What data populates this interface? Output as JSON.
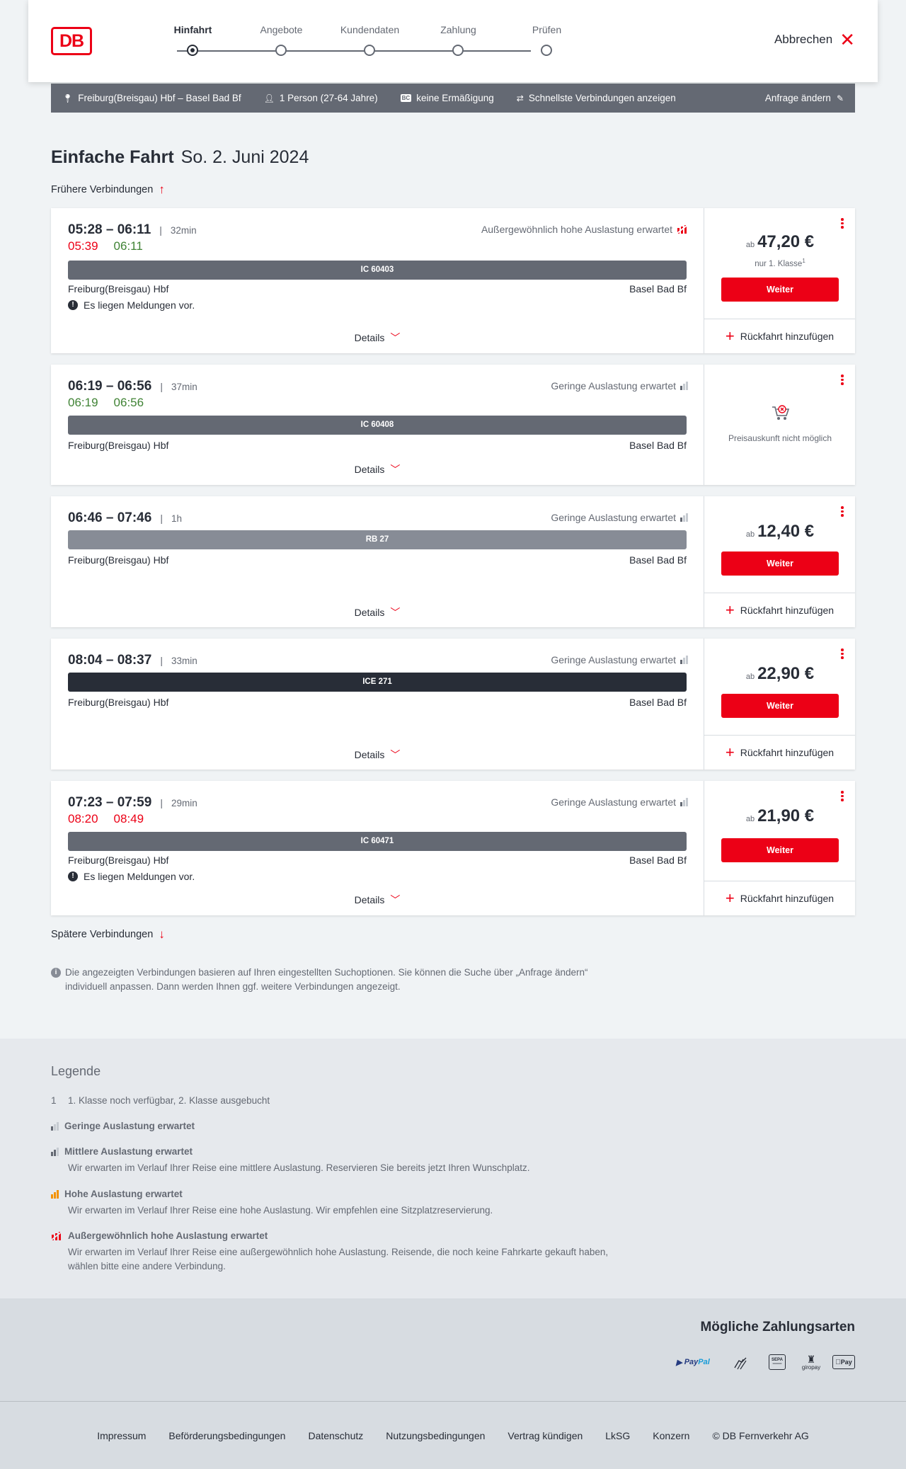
{
  "header": {
    "logo": "DB",
    "steps": [
      "Hinfahrt",
      "Angebote",
      "Kundendaten",
      "Zahlung",
      "Prüfen"
    ],
    "active_step": 0,
    "cancel_label": "Abbrechen"
  },
  "summary": {
    "route": "Freiburg(Breisgau) Hbf – Basel Bad Bf",
    "persons": "1 Person (27-64 Jahre)",
    "discount_badge": "BC",
    "discount": "keine Ermäßigung",
    "option": "Schnellste Verbindungen anzeigen",
    "edit_label": "Anfrage ändern"
  },
  "title": {
    "label": "Einfache Fahrt",
    "date": "So. 2. Juni 2024"
  },
  "earlier_label": "Frühere Verbindungen",
  "later_label": "Spätere Verbindungen",
  "connections": [
    {
      "times": "05:28 – 06:11",
      "duration": "32min",
      "rt_dep": "05:39",
      "rt_arr": "06:11",
      "load": "Außergewöhnlich hohe Auslastung erwartet",
      "train": "IC 60403",
      "from": "Freiburg(Breisgau) Hbf",
      "to": "Basel Bad Bf",
      "message": "Es liegen Meldungen vor.",
      "price_prefix": "ab",
      "price": "47,20 €",
      "price_note": "nur 1. Klasse",
      "price_note_ref": "1",
      "button": "Weiter",
      "return": "Rückfahrt hinzufügen",
      "details": "Details"
    },
    {
      "times": "06:19 – 06:56",
      "duration": "37min",
      "rt_dep": "06:19",
      "rt_arr": "06:56",
      "load": "Geringe Auslastung erwartet",
      "train": "IC 60408",
      "from": "Freiburg(Breisgau) Hbf",
      "to": "Basel Bad Bf",
      "no_price": "Preisauskunft nicht möglich",
      "details": "Details"
    },
    {
      "times": "06:46 – 07:46",
      "duration": "1h",
      "load": "Geringe Auslastung erwartet",
      "train": "RB 27",
      "from": "Freiburg(Breisgau) Hbf",
      "to": "Basel Bad Bf",
      "price_prefix": "ab",
      "price": "12,40 €",
      "button": "Weiter",
      "return": "Rückfahrt hinzufügen",
      "details": "Details"
    },
    {
      "times": "08:04 – 08:37",
      "duration": "33min",
      "load": "Geringe Auslastung erwartet",
      "train": "ICE 271",
      "from": "Freiburg(Breisgau) Hbf",
      "to": "Basel Bad Bf",
      "price_prefix": "ab",
      "price": "22,90 €",
      "button": "Weiter",
      "return": "Rückfahrt hinzufügen",
      "details": "Details"
    },
    {
      "times": "07:23 – 07:59",
      "duration": "29min",
      "rt_dep": "08:20",
      "rt_arr": "08:49",
      "load": "Geringe Auslastung erwartet",
      "train": "IC 60471",
      "from": "Freiburg(Breisgau) Hbf",
      "to": "Basel Bad Bf",
      "message": "Es liegen Meldungen vor.",
      "price_prefix": "ab",
      "price": "21,90 €",
      "button": "Weiter",
      "return": "Rückfahrt hinzufügen",
      "details": "Details"
    }
  ],
  "info_text": "Die angezeigten Verbindungen basieren auf Ihren eingestellten Suchoptionen. Sie können die Suche über „Anfrage ändern“ individuell anpassen. Dann werden Ihnen ggf. weitere Verbindungen angezeigt.",
  "legend": {
    "title": "Legende",
    "footnote_num": "1",
    "footnote": "1. Klasse noch verfügbar, 2. Klasse ausgebucht",
    "low": "Geringe Auslastung erwartet",
    "mid": "Mittlere Auslastung erwartet",
    "mid_text": "Wir erwarten im Verlauf Ihrer Reise eine mittlere Auslastung. Reservieren Sie bereits jetzt Ihren Wunschplatz.",
    "high": "Hohe Auslastung erwartet",
    "high_text": "Wir erwarten im Verlauf Ihrer Reise eine hohe Auslastung. Wir empfehlen eine Sitzplatzreservierung.",
    "xhigh": "Außergewöhnlich hohe Auslastung erwartet",
    "xhigh_text": "Wir erwarten im Verlauf Ihrer Reise eine außergewöhnlich hohe Auslastung. Reisende, die noch keine Fahrkarte gekauft haben, wählen bitte eine andere Verbindung."
  },
  "payment": {
    "title": "Mögliche Zahlungsarten",
    "paypal_a": "Pay",
    "paypal_b": "Pal",
    "sepa": "SEPA",
    "giropay": "giropay",
    "applepay": "Pay"
  },
  "footer": [
    "Impressum",
    "Beförderungsbedingungen",
    "Datenschutz",
    "Nutzungsbedingungen",
    "Vertrag kündigen",
    "LkSG",
    "Konzern",
    "© DB Fernverkehr AG"
  ],
  "colors": {
    "accent": "#ec0016",
    "ontime": "#408335",
    "bar_ic": "#646973",
    "bar_rb": "#878c96",
    "bar_ice": "#282d37"
  }
}
